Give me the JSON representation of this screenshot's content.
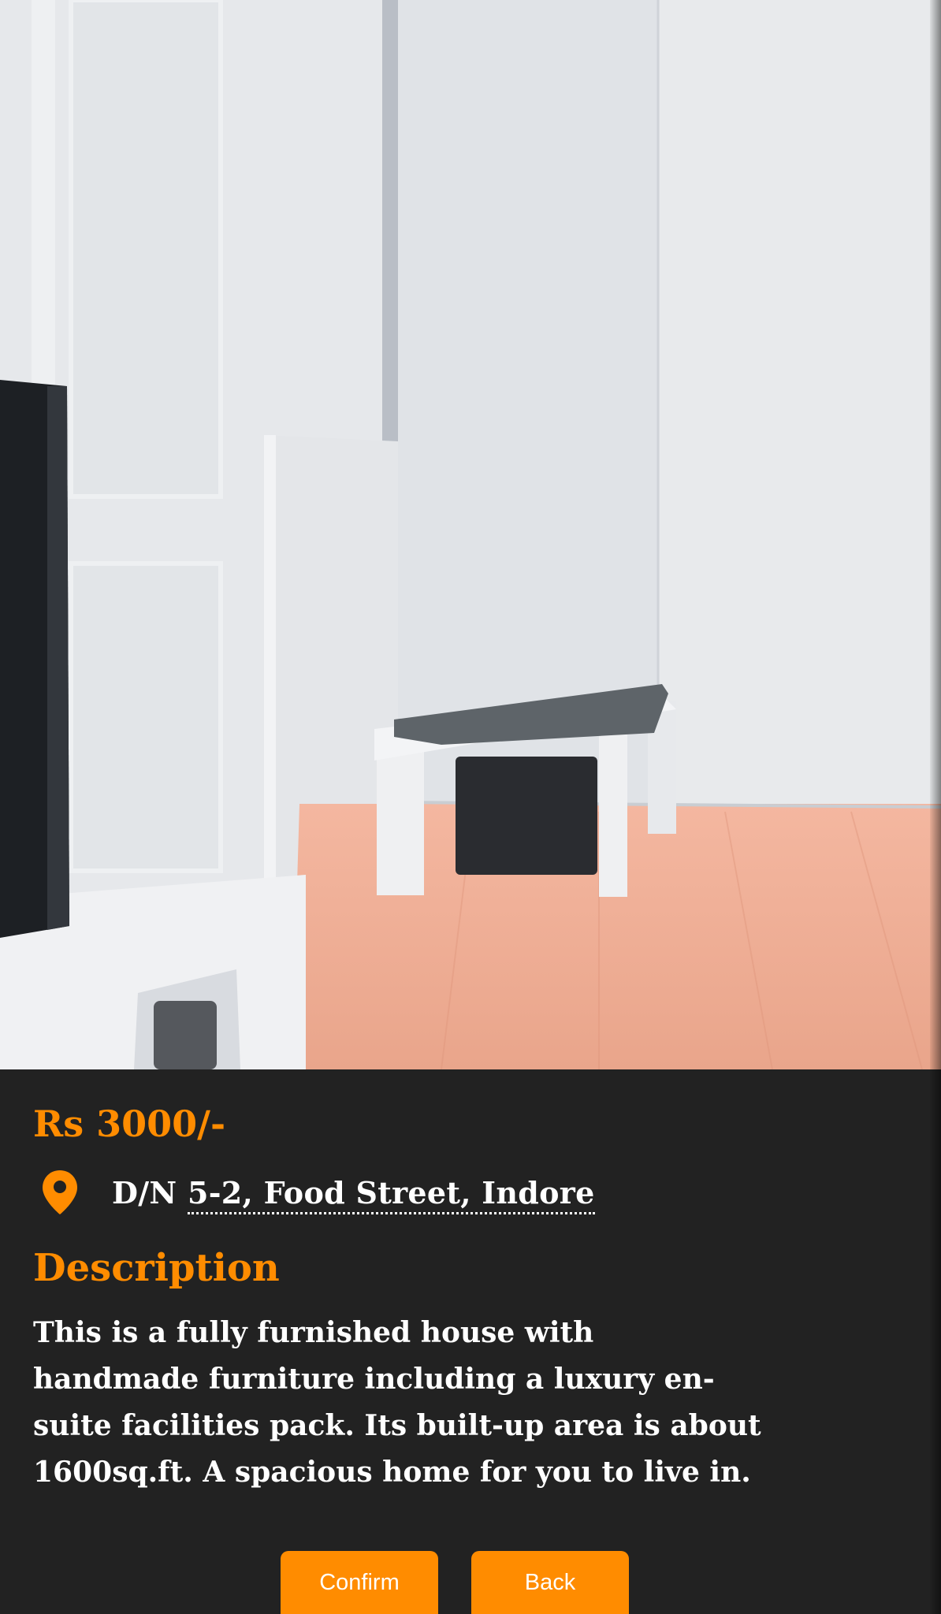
{
  "listing": {
    "price": "Rs 3000/-",
    "address_prefix": "D/N",
    "address_link": "5-2, Food Street, Indore",
    "description_heading": "Description",
    "description_text": "This is a fully furnished house with handmade furniture including a luxury en-suite facilities pack. Its built-up area is about 1600sq.ft. A spacious home for you to live in."
  },
  "actions": {
    "confirm_label": "Confirm",
    "back_label": "Back"
  },
  "icons": {
    "location": "map-pin-icon"
  },
  "colors": {
    "accent": "#ff8c00",
    "background": "#222222",
    "text": "#ffffff"
  }
}
